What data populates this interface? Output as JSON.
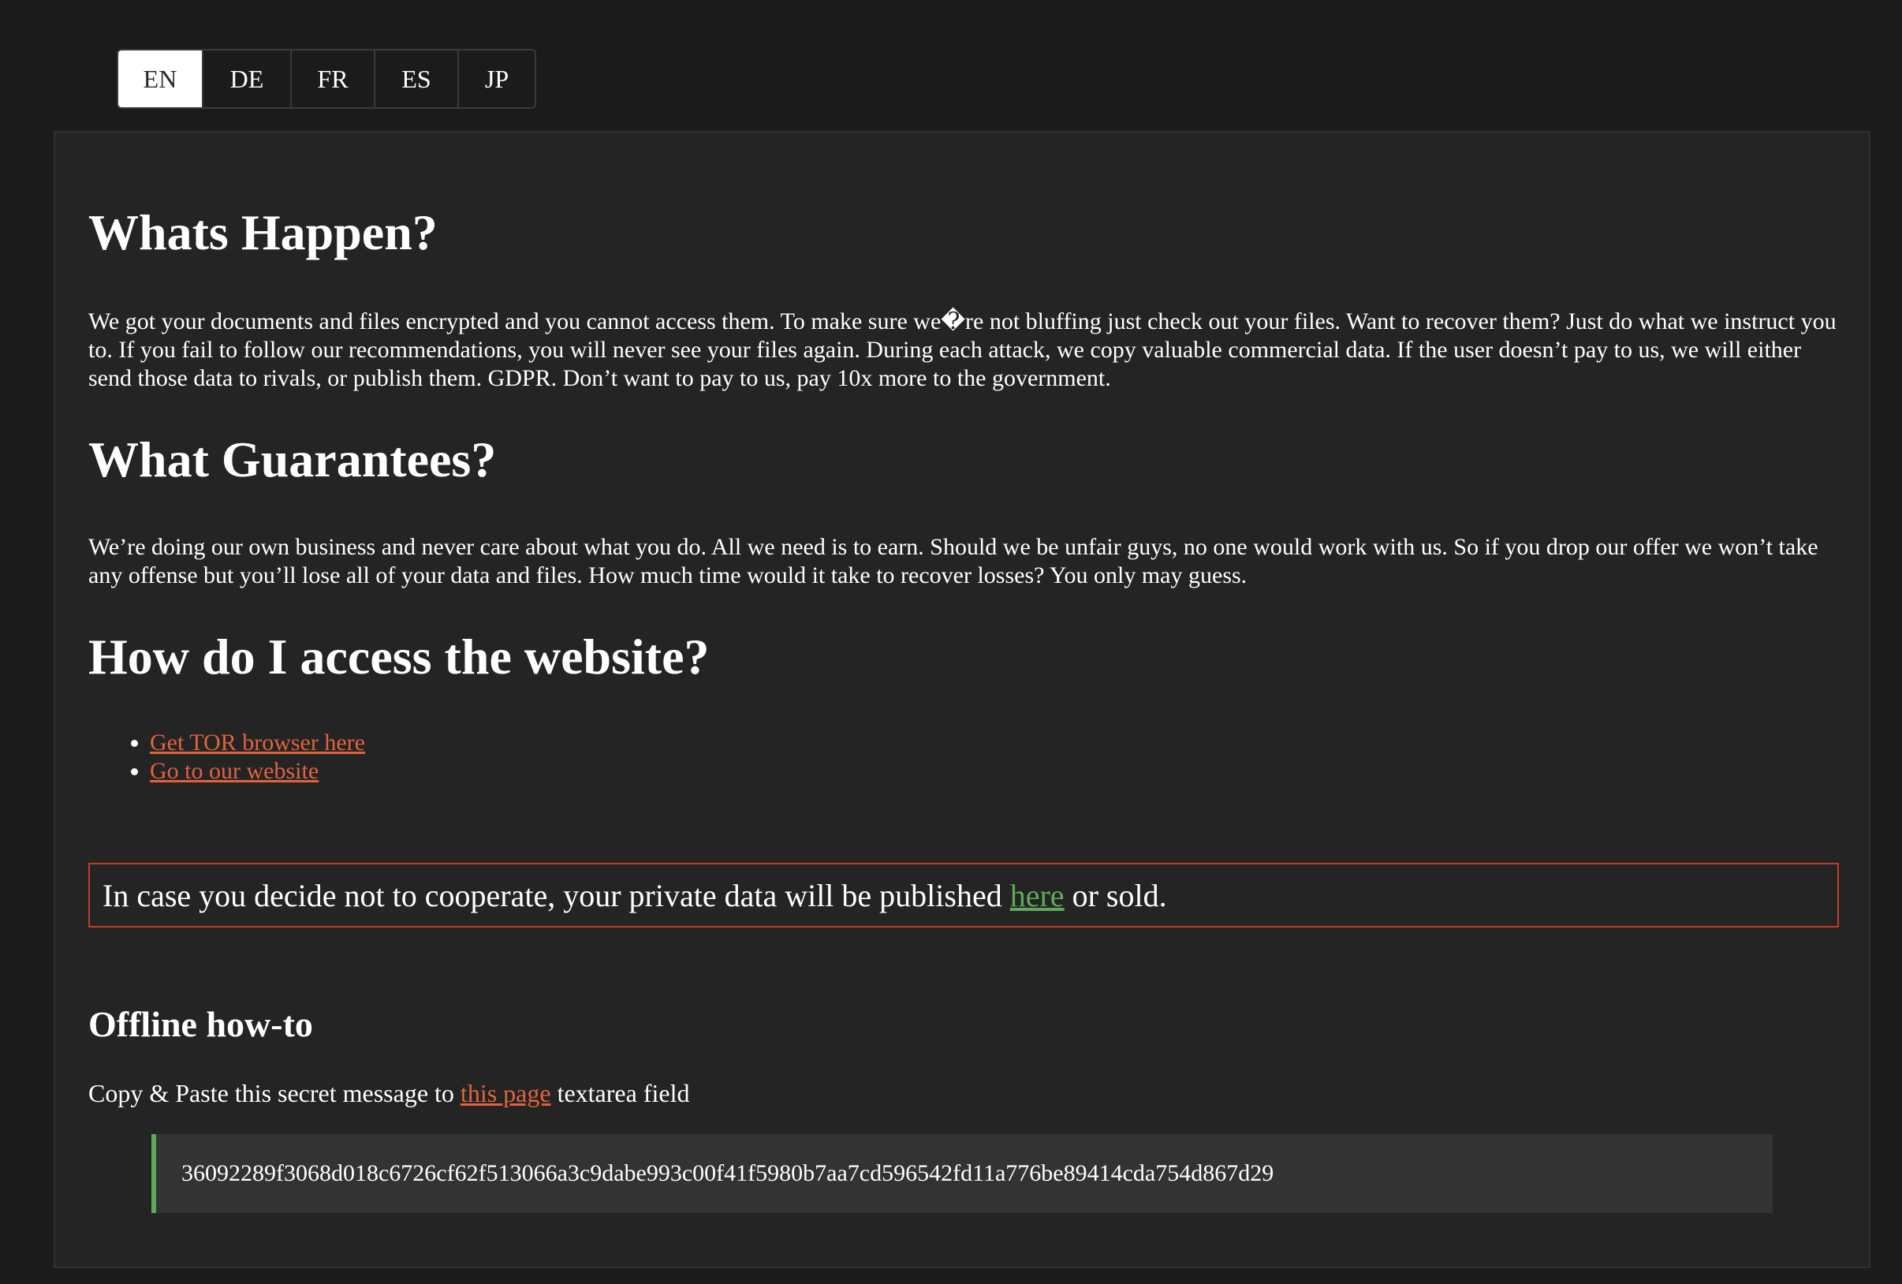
{
  "language_tabs": [
    {
      "label": "EN",
      "active": true
    },
    {
      "label": "DE",
      "active": false
    },
    {
      "label": "FR",
      "active": false
    },
    {
      "label": "ES",
      "active": false
    },
    {
      "label": "JP",
      "active": false
    }
  ],
  "sections": {
    "whats_happen": {
      "heading": "Whats Happen?",
      "body": "We got your documents and files encrypted and you cannot access them. To make sure we�re not bluffing just check out your files. Want to recover them? Just do what we instruct you to. If you fail to follow our recommendations, you will never see your files again. During each attack, we copy valuable commercial data. If the user doesn’t pay to us, we will either send those data to rivals, or publish them. GDPR. Don’t want to pay to us, pay 10x more to the government."
    },
    "guarantees": {
      "heading": "What Guarantees?",
      "body": "We’re doing our own business and never care about what you do. All we need is to earn. Should we be unfair guys, no one would work with us. So if you drop our offer we won’t take any offense but you’ll lose all of your data and files. How much time would it take to recover losses? You only may guess."
    },
    "access": {
      "heading": "How do I access the website?",
      "links": [
        "Get TOR browser here",
        "Go to our website"
      ]
    },
    "warning": {
      "prefix": "In case you decide not to cooperate, your private data will be published",
      "link": "here",
      "suffix": "or sold."
    },
    "offline": {
      "heading": "Offline how-to",
      "instruction_prefix": "Copy & Paste this secret message to",
      "instruction_link": "this page",
      "instruction_suffix": "textarea field",
      "secret": "36092289f3068d018c6726cf62f513066a3c9dabe993c00f41f5980b7aa7cd596542fd11a776be89414cda754d867d29"
    }
  }
}
